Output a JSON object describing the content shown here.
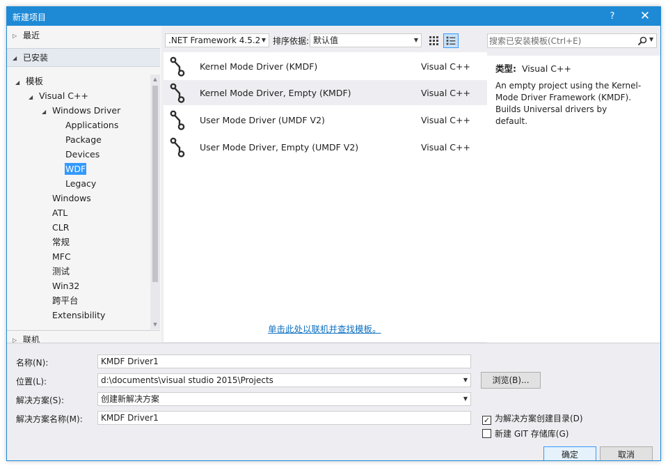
{
  "window": {
    "title": "新建项目",
    "help": "?",
    "close": "✕"
  },
  "left": {
    "recent": "最近",
    "installed": "已安装",
    "online": "联机",
    "tree": [
      {
        "label": "模板",
        "arrow": "◢"
      },
      {
        "label": "Visual C++",
        "arrow": "◢"
      },
      {
        "label": "Windows Driver",
        "arrow": "◢"
      },
      {
        "label": "Applications",
        "arrow": ""
      },
      {
        "label": "Package",
        "arrow": ""
      },
      {
        "label": "Devices",
        "arrow": ""
      },
      {
        "label": "WDF",
        "arrow": ""
      },
      {
        "label": "Legacy",
        "arrow": ""
      },
      {
        "label": "Windows",
        "arrow": ""
      },
      {
        "label": "ATL",
        "arrow": ""
      },
      {
        "label": "CLR",
        "arrow": ""
      },
      {
        "label": "常规",
        "arrow": ""
      },
      {
        "label": "MFC",
        "arrow": ""
      },
      {
        "label": "测试",
        "arrow": ""
      },
      {
        "label": "Win32",
        "arrow": ""
      },
      {
        "label": "跨平台",
        "arrow": ""
      },
      {
        "label": "Extensibility",
        "arrow": ""
      }
    ]
  },
  "toolbar": {
    "framework": ".NET Framework 4.5.2",
    "sort_label": "排序依据:",
    "sort_value": "默认值"
  },
  "templates": [
    {
      "name": "Kernel Mode Driver (KMDF)",
      "lang": "Visual C++"
    },
    {
      "name": "Kernel Mode Driver, Empty (KMDF)",
      "lang": "Visual C++"
    },
    {
      "name": "User Mode Driver (UMDF V2)",
      "lang": "Visual C++"
    },
    {
      "name": "User Mode Driver, Empty (UMDF V2)",
      "lang": "Visual C++"
    }
  ],
  "online_link": "单击此处以联机并查找模板。",
  "search": {
    "placeholder": "搜索已安装模板(Ctrl+E)"
  },
  "details": {
    "type_label": "类型:",
    "type_value": "Visual C++",
    "description": "An empty project using the Kernel-Mode Driver Framework (KMDF). Builds Universal drivers by default."
  },
  "form": {
    "name_label": "名称(N):",
    "name_value": "KMDF Driver1",
    "location_label": "位置(L):",
    "location_value": "d:\\documents\\visual studio 2015\\Projects",
    "solution_label": "解决方案(S):",
    "solution_value": "创建新解决方案",
    "solution_name_label": "解决方案名称(M):",
    "solution_name_value": "KMDF Driver1",
    "browse": "浏览(B)...",
    "create_dir": "为解决方案创建目录(D)",
    "create_dir_checked": true,
    "git": "新建 GIT 存储库(G)",
    "git_checked": false,
    "ok": "确定",
    "cancel": "取消"
  },
  "colors": {
    "accent": "#1e8ad6",
    "selection": "#3399ff",
    "link": "#0e70c0"
  }
}
